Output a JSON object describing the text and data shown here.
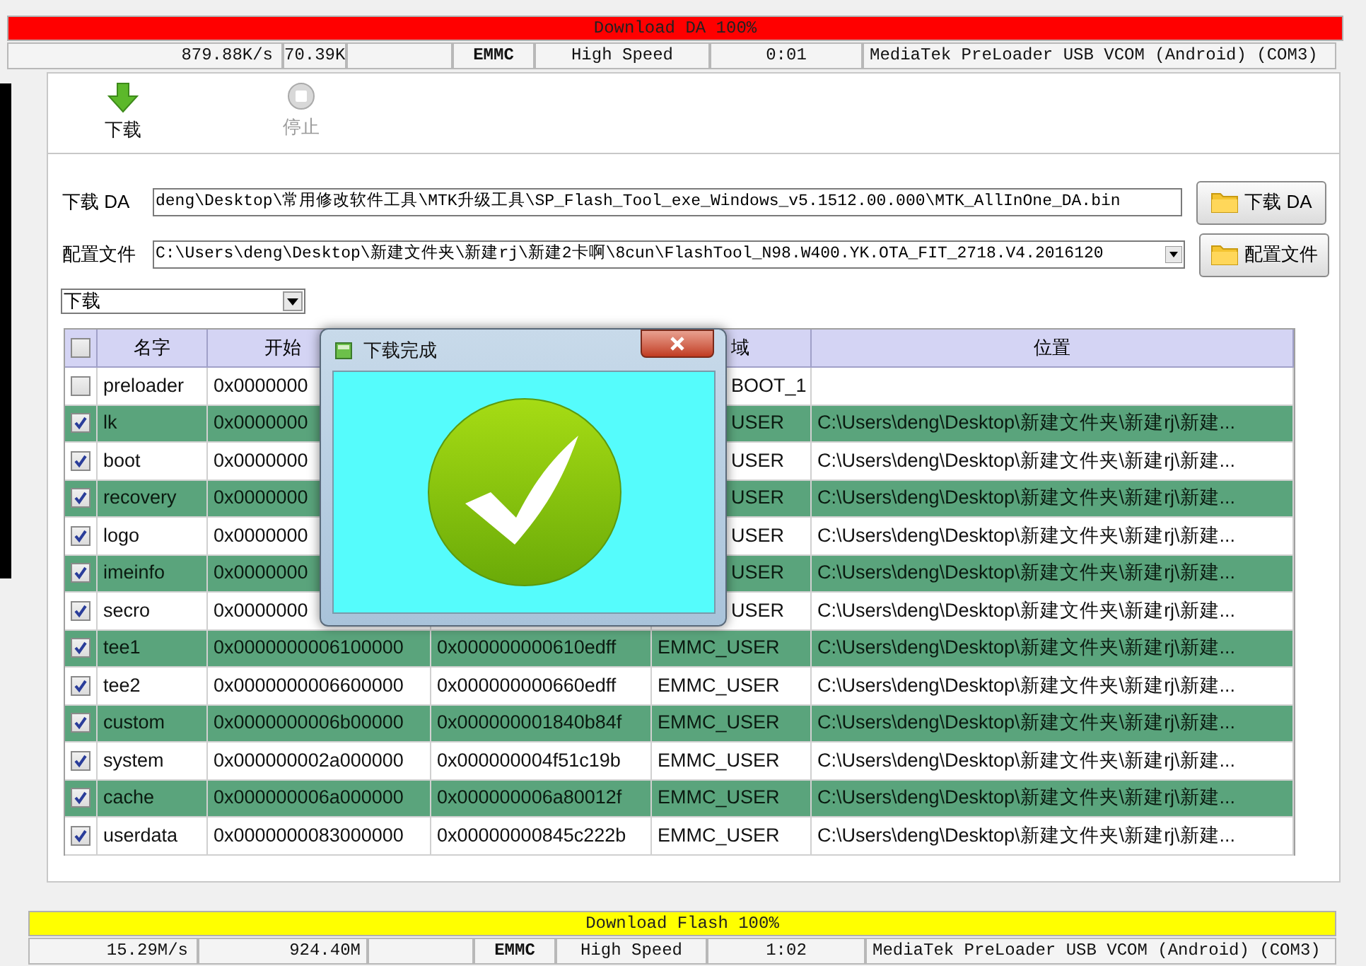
{
  "status_panels": [
    {
      "bar_text": "Download DA 100%",
      "level": 1,
      "color": "#ff0000",
      "speed": "879.88K/s",
      "size": "70.39K",
      "storage": "EMMC",
      "mode": "High Speed",
      "time": "0:01",
      "device": "MediaTek PreLoader USB VCOM (Android) (COM3)"
    },
    {
      "bar_text": "Download Flash 100%",
      "level": 1,
      "color": "#ffff00",
      "speed": "15.29M/s",
      "size": "924.40M",
      "storage": "EMMC",
      "mode": "High Speed",
      "time": "1:02",
      "device": "MediaTek PreLoader USB VCOM (Android) (COM3)"
    }
  ],
  "toolbar": [
    {
      "label": "下载",
      "disabled": false
    },
    {
      "label": "停止",
      "disabled": true
    }
  ],
  "da": {
    "label": "下载 DA",
    "value": "deng\\Desktop\\常用修改软件工具\\MTK升级工具\\SP_Flash_Tool_exe_Windows_v5.1512.00.000\\MTK_AllInOne_DA.bin",
    "button": "下载 DA"
  },
  "scatter": {
    "label": "配置文件",
    "value": "C:\\Users\\deng\\Desktop\\新建文件夹\\新建rj\\新建2卡啊\\8cun\\FlashTool_N98.W400.YK.OTA_FIT_2718.V4.2016120",
    "button": "配置文件"
  },
  "mode_select": {
    "value": "下载"
  },
  "table": {
    "all_checked": false,
    "header": {
      "name": "名字",
      "start": "开始",
      "region": "域",
      "location": "位置"
    },
    "rows": [
      {
        "checked": false,
        "name": "preloader",
        "start": "0x0000000",
        "region": "BOOT_1"
      },
      {
        "checked": true,
        "name": "lk",
        "start": "0x0000000",
        "region": "USER",
        "location": "C:\\Users\\deng\\Desktop\\新建文件夹\\新建rj\\新建..."
      },
      {
        "checked": true,
        "name": "boot",
        "start": "0x0000000",
        "region": "USER",
        "location": "C:\\Users\\deng\\Desktop\\新建文件夹\\新建rj\\新建..."
      },
      {
        "checked": true,
        "name": "recovery",
        "start": "0x0000000",
        "region": "USER",
        "location": "C:\\Users\\deng\\Desktop\\新建文件夹\\新建rj\\新建..."
      },
      {
        "checked": true,
        "name": "logo",
        "start": "0x0000000",
        "region": "USER",
        "location": "C:\\Users\\deng\\Desktop\\新建文件夹\\新建rj\\新建..."
      },
      {
        "checked": true,
        "name": "imeinfo",
        "start": "0x0000000",
        "region": "USER",
        "location": "C:\\Users\\deng\\Desktop\\新建文件夹\\新建rj\\新建..."
      },
      {
        "checked": true,
        "name": "secro",
        "start": "0x0000000",
        "region": "USER",
        "location": "C:\\Users\\deng\\Desktop\\新建文件夹\\新建rj\\新建..."
      },
      {
        "checked": true,
        "name": "tee1",
        "start": "0x0000000006100000",
        "end": "0x000000000610edff",
        "region": "EMMC_USER",
        "location": "C:\\Users\\deng\\Desktop\\新建文件夹\\新建rj\\新建..."
      },
      {
        "checked": true,
        "name": "tee2",
        "start": "0x0000000006600000",
        "end": "0x000000000660edff",
        "region": "EMMC_USER",
        "location": "C:\\Users\\deng\\Desktop\\新建文件夹\\新建rj\\新建..."
      },
      {
        "checked": true,
        "name": "custom",
        "start": "0x0000000006b00000",
        "end": "0x000000001840b84f",
        "region": "EMMC_USER",
        "location": "C:\\Users\\deng\\Desktop\\新建文件夹\\新建rj\\新建..."
      },
      {
        "checked": true,
        "name": "system",
        "start": "0x000000002a000000",
        "end": "0x000000004f51c19b",
        "region": "EMMC_USER",
        "location": "C:\\Users\\deng\\Desktop\\新建文件夹\\新建rj\\新建..."
      },
      {
        "checked": true,
        "name": "cache",
        "start": "0x000000006a000000",
        "end": "0x000000006a80012f",
        "region": "EMMC_USER",
        "location": "C:\\Users\\deng\\Desktop\\新建文件夹\\新建rj\\新建..."
      },
      {
        "checked": true,
        "name": "userdata",
        "start": "0x0000000083000000",
        "end": "0x00000000845c222b",
        "region": "EMMC_USER",
        "location": "C:\\Users\\deng\\Desktop\\新建文件夹\\新建rj\\新建..."
      }
    ]
  },
  "dialog": {
    "title": "下载完成"
  }
}
